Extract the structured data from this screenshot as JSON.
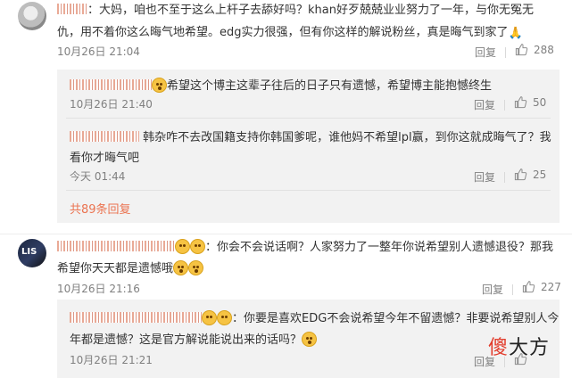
{
  "comments": [
    {
      "body_line1": "：大妈，咱也不至于这么上杆子去舔好吗？khan好歹兢兢业业努力了一年，与你无冤无",
      "body_line2": "仇，用不着你这么晦气地希望。edg实力很强，但有你这样的解说粉丝，真是晦气到家了",
      "time": "10月26日 21:04",
      "reply": "回复",
      "likes": "288"
    },
    {
      "body_line1": "你会不会说话啊？人家努力了一整年你说希望别人遗憾退役？那我",
      "body_line2": "希望你天天都是遗憾哦",
      "time": "10月26日 21:16",
      "reply": "回复",
      "likes": "227"
    }
  ],
  "replies_first": [
    {
      "body": "希望这个博主这辈子往后的日子只有遗憾，希望博主能抱憾终生",
      "time": "10月26日 21:40",
      "reply": "回复",
      "likes": "50"
    },
    {
      "body_line1": "韩杂咋不去改国籍支持你韩国爹呢，谁他妈不希望lpl赢，到你这就成晦气了？我",
      "body_line2": "看你才晦气吧",
      "time": "今天 01:44",
      "reply": "回复",
      "likes": "25"
    }
  ],
  "more_replies": "共89条回复",
  "replies_second": [
    {
      "body_line1": "你要是喜欢EDG不会说希望今年不留遗憾？非要说希望别人今",
      "body_line2": "年都是遗憾？这是官方解说能说出来的话吗？",
      "time": "10月26日 21:21",
      "reply": "回复"
    }
  ],
  "watermark": {
    "part1": "傻",
    "part2": "大方"
  },
  "icons": [
    "thumbs-up-icon",
    "emoji-icon",
    "pray-icon"
  ],
  "colors": {
    "username": "#eb7350",
    "link": "#eb7350",
    "reply_bg": "#f2f2f2",
    "meta": "#808080"
  }
}
